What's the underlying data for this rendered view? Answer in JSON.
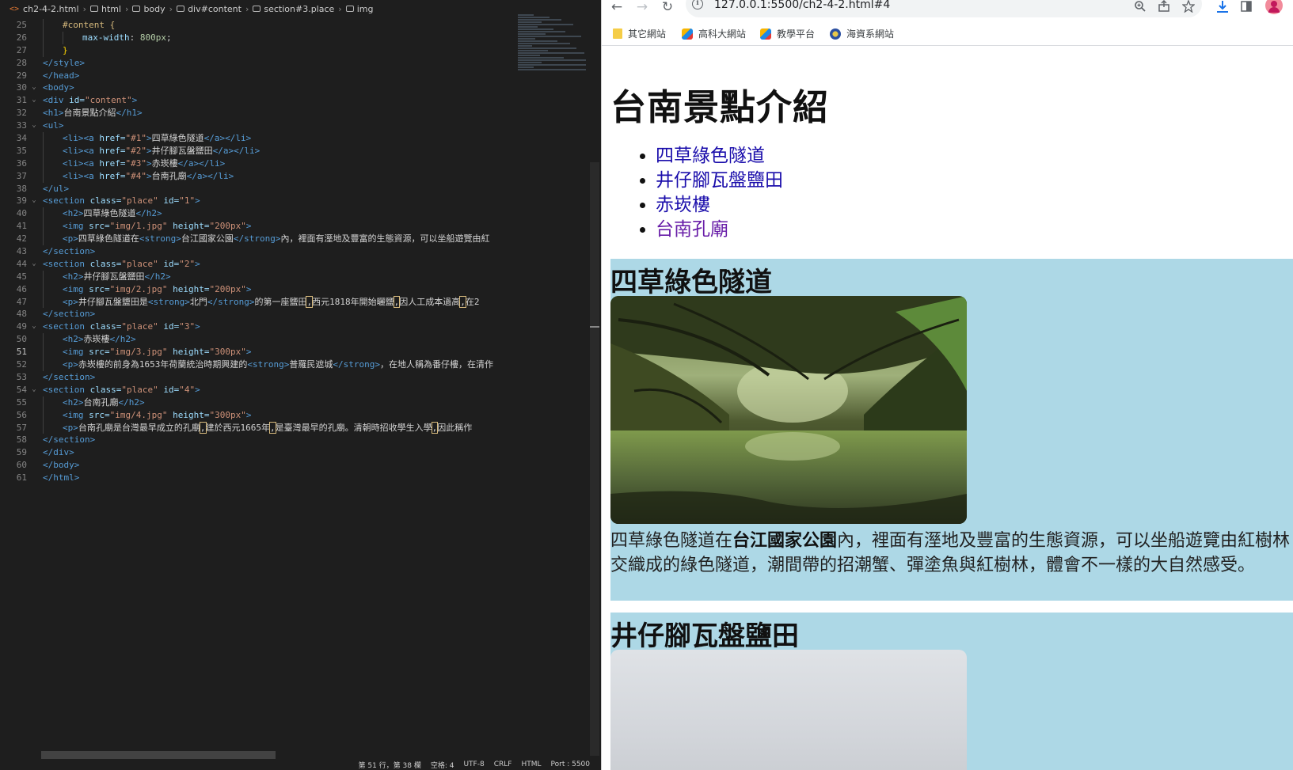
{
  "editor": {
    "breadcrumb": {
      "file_icon": "<>",
      "file": "ch2-4-2.html",
      "crumbs": [
        "html",
        "body",
        "div#content",
        "section#3.place",
        "img"
      ]
    },
    "line_numbers": [
      "25",
      "26",
      "27",
      "28",
      "29",
      "30",
      "31",
      "32",
      "33",
      "34",
      "35",
      "36",
      "37",
      "38",
      "39",
      "40",
      "41",
      "42",
      "43",
      "44",
      "45",
      "46",
      "47",
      "48",
      "49",
      "50",
      "51",
      "52",
      "53",
      "54",
      "55",
      "56",
      "57",
      "58",
      "59",
      "60",
      "61"
    ],
    "active_line": "51",
    "code": {
      "l25_sel": "#content {",
      "l26_prop": "max-width",
      "l26_val": "800px",
      "l27": "}",
      "l28": "</style>",
      "l29": "</head>",
      "l30": "<body>",
      "l31_tag": "<div",
      "l31_attr": "id=",
      "l31_val": "\"content\"",
      "l32_open": "<h1>",
      "l32_text": "台南景點介紹",
      "l32_close": "</h1>",
      "l33": "<ul>",
      "l34_href": "\"#1\"",
      "l34_text": "四草綠色隧道",
      "l35_href": "\"#2\"",
      "l35_text": "井仔腳瓦盤鹽田",
      "l36_href": "\"#3\"",
      "l36_text": "赤崁樓",
      "l37_href": "\"#4\"",
      "l37_text": "台南孔廟",
      "l38": "</ul>",
      "l39_id": "\"1\"",
      "l40_text": "四草綠色隧道",
      "l41_src": "\"img/1.jpg\"",
      "l41_h": "\"200px\"",
      "l42_pre": "四草綠色隧道在",
      "l42_strong": "台江國家公園",
      "l42_post": "內，裡面有溼地及豐富的生態資源，可以坐船遊覽由紅",
      "l43": "</section>",
      "l44_id": "\"2\"",
      "l45_text": "井仔腳瓦盤鹽田",
      "l46_src": "\"img/2.jpg\"",
      "l46_h": "\"200px\"",
      "l47_pre": "井仔腳瓦盤鹽田是",
      "l47_strong": "北門",
      "l47_post1": "的第一座鹽田",
      "l47_post2": "西元1818年開始曬鹽",
      "l47_post3": "因人工成本過高",
      "l47_post4": "在2",
      "l48": "</section>",
      "l49_id": "\"3\"",
      "l50_text": "赤崁樓",
      "l51_src": "\"img/3.jpg\"",
      "l51_h": "\"300px\"",
      "l52_pre": "赤崁樓的前身為1653年荷蘭統治時期興建的",
      "l52_strong": "普羅民遮城",
      "l52_post": "，在地人稱為番仔樓，在清作",
      "l53": "</section>",
      "l54_id": "\"4\"",
      "l55_text": "台南孔廟",
      "l56_src": "\"img/4.jpg\"",
      "l56_h": "\"300px\"",
      "l57_pre": "台南孔廟是台灣最早成立的孔廟",
      "l57_mid": "建於西元1665年",
      "l57_mid2": "是臺灣最早的孔廟。清朝時招收學生入學",
      "l57_post": "因此稱作",
      "l58": "</section>",
      "l59": "</div>",
      "l60": "</body>",
      "l61": "</html>"
    },
    "status_items": [
      "第 51 行，第 38 欄",
      "空格: 4",
      "UTF-8",
      "CRLF",
      "HTML",
      "Port : 5500"
    ]
  },
  "browser": {
    "url": "127.0.0.1:5500/ch2-4-2.html#4",
    "nav": {
      "back": "←",
      "forward": "→",
      "reload": "↻"
    },
    "bookmarks": [
      "其它網站",
      "高科大網站",
      "教學平台",
      "海資系網站"
    ],
    "page": {
      "title": "台南景點介紹",
      "toc": [
        "四草綠色隧道",
        "井仔腳瓦盤鹽田",
        "赤崁樓",
        "台南孔廟"
      ],
      "section1": {
        "heading": "四草綠色隧道",
        "p_pre": "四草綠色隧道在",
        "p_strong": "台江國家公園",
        "p_post": "內，裡面有溼地及豐富的生態資源，可以坐船遊覽由紅樹林交織成的綠色隧道，潮間帶的招潮蟹、彈塗魚與紅樹林，體會不一樣的大自然感受。"
      },
      "section2": {
        "heading": "井仔腳瓦盤鹽田"
      }
    },
    "colors": {
      "section_bg": "#add8e6",
      "link": "#1a0dab",
      "visited": "#681da8"
    }
  }
}
